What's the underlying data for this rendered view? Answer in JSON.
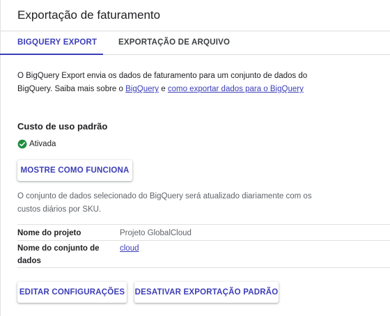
{
  "header": {
    "title": "Exportação de faturamento"
  },
  "tabs": [
    {
      "label": "BIGQUERY EXPORT",
      "active": true
    },
    {
      "label": "EXPORTAÇÃO DE ARQUIVO",
      "active": false
    }
  ],
  "intro": {
    "text_before": "O BigQuery Export envia os dados de faturamento para um conjunto de dados do BigQuery. Saiba mais sobre o ",
    "link_bigquery": "BigQuery",
    "text_middle": " e ",
    "link_export": "como exportar dados para o BigQuery"
  },
  "standard_usage": {
    "title": "Custo de uso padrão",
    "status_label": "Ativada",
    "status_icon": "check-circle-icon",
    "status_color": "#1e8e3e",
    "show_how_button": "MOSTRE COMO FUNCIONA",
    "description": "O conjunto de dados selecionado do BigQuery será atualizado diariamente com os custos diários por SKU."
  },
  "details": [
    {
      "label": "Nome do projeto",
      "value": "Projeto GlobalCloud"
    },
    {
      "label": "Nome do conjunto de dados",
      "value": "cloud"
    }
  ],
  "actions": {
    "edit_settings": "EDITAR CONFIGURAÇÕES",
    "disable_export": "DESATIVAR EXPORTAÇÃO PADRÃO"
  },
  "colors": {
    "accent": "#3b3db7",
    "success": "#1e8e3e"
  }
}
